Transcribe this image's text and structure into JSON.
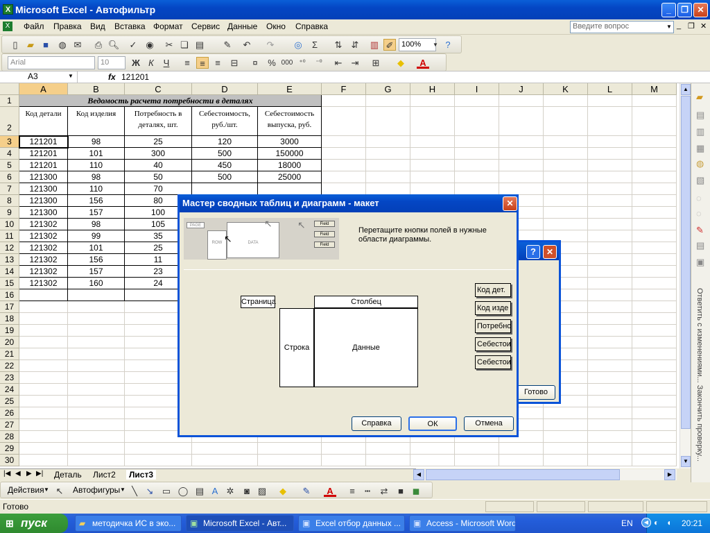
{
  "window": {
    "title": "Microsoft Excel - Автофильтр"
  },
  "menu": {
    "items": [
      "Файл",
      "Правка",
      "Вид",
      "Вставка",
      "Формат",
      "Сервис",
      "Данные",
      "Окно",
      "Справка"
    ],
    "ask_placeholder": "Введите вопрос"
  },
  "toolbar": {
    "zoom": "100%",
    "font": "Arial",
    "size": "10",
    "bold": "Ж",
    "italic": "К",
    "underline": "Ч",
    "percent": "%",
    "thousands": "000"
  },
  "formula": {
    "cell_ref": "A3",
    "fx": "fx",
    "value": "121201"
  },
  "columns": [
    "A",
    "B",
    "C",
    "D",
    "E",
    "F",
    "G",
    "H",
    "I",
    "J",
    "K",
    "L",
    "M"
  ],
  "rows": [
    "1",
    "2",
    "3",
    "4",
    "5",
    "6",
    "7",
    "8",
    "9",
    "10",
    "11",
    "12",
    "13",
    "14",
    "15",
    "16",
    "17",
    "18",
    "19",
    "20",
    "21",
    "22",
    "23",
    "24",
    "25",
    "26",
    "27",
    "28",
    "29",
    "30"
  ],
  "sheet": {
    "title": "Ведомость расчета потребности в деталях",
    "headers": [
      "Код детали",
      "Код изделия",
      "Потребность в деталях, шт.",
      "Себестоимость, руб./шт.",
      "Себестоимость выпуска, руб."
    ],
    "data": [
      [
        "121201",
        "98",
        "25",
        "120",
        "3000"
      ],
      [
        "121201",
        "101",
        "300",
        "500",
        "150000"
      ],
      [
        "121201",
        "110",
        "40",
        "450",
        "18000"
      ],
      [
        "121300",
        "98",
        "50",
        "500",
        "25000"
      ],
      [
        "121300",
        "110",
        "70",
        "",
        ""
      ],
      [
        "121300",
        "156",
        "80",
        "",
        ""
      ],
      [
        "121300",
        "157",
        "100",
        "",
        ""
      ],
      [
        "121302",
        "98",
        "105",
        "",
        ""
      ],
      [
        "121302",
        "99",
        "35",
        "",
        ""
      ],
      [
        "121302",
        "101",
        "25",
        "",
        ""
      ],
      [
        "121302",
        "156",
        "11",
        "",
        ""
      ],
      [
        "121302",
        "157",
        "23",
        "",
        ""
      ],
      [
        "121302",
        "160",
        "24",
        "",
        ""
      ]
    ]
  },
  "tabs": [
    "Деталь",
    "Лист2",
    "Лист3"
  ],
  "drawbar": {
    "actions": "Действия",
    "autoshapes": "Автофигуры"
  },
  "status": {
    "text": "Готово"
  },
  "taskpane": {
    "text": "Ответить с изменениями...  Закончить проверку..."
  },
  "back_dialog": {
    "finish": "Готово"
  },
  "dialog": {
    "title": "Мастер сводных таблиц и диаграмм - макет",
    "instruction": "Перетащите кнопки полей в нужные области диаграммы.",
    "preview_labels": [
      "PAGE",
      "ROW",
      "DATA",
      "Field",
      "Field",
      "Field"
    ],
    "zones": {
      "page": "Страница",
      "column": "Столбец",
      "row": "Строка",
      "data": "Данные"
    },
    "fields": [
      "Код дет.",
      "Код изде",
      "Потребно",
      "Себестои",
      "Себестои"
    ],
    "buttons": {
      "help": "Справка",
      "ok": "ОК",
      "cancel": "Отмена"
    }
  },
  "taskbar": {
    "start": "пуск",
    "tasks": [
      "методичка ИС в эко...",
      "Microsoft Excel - Авт...",
      "Excel отбор данных ...",
      "Access - Microsoft Word"
    ],
    "lang": "EN",
    "time": "20:21"
  }
}
